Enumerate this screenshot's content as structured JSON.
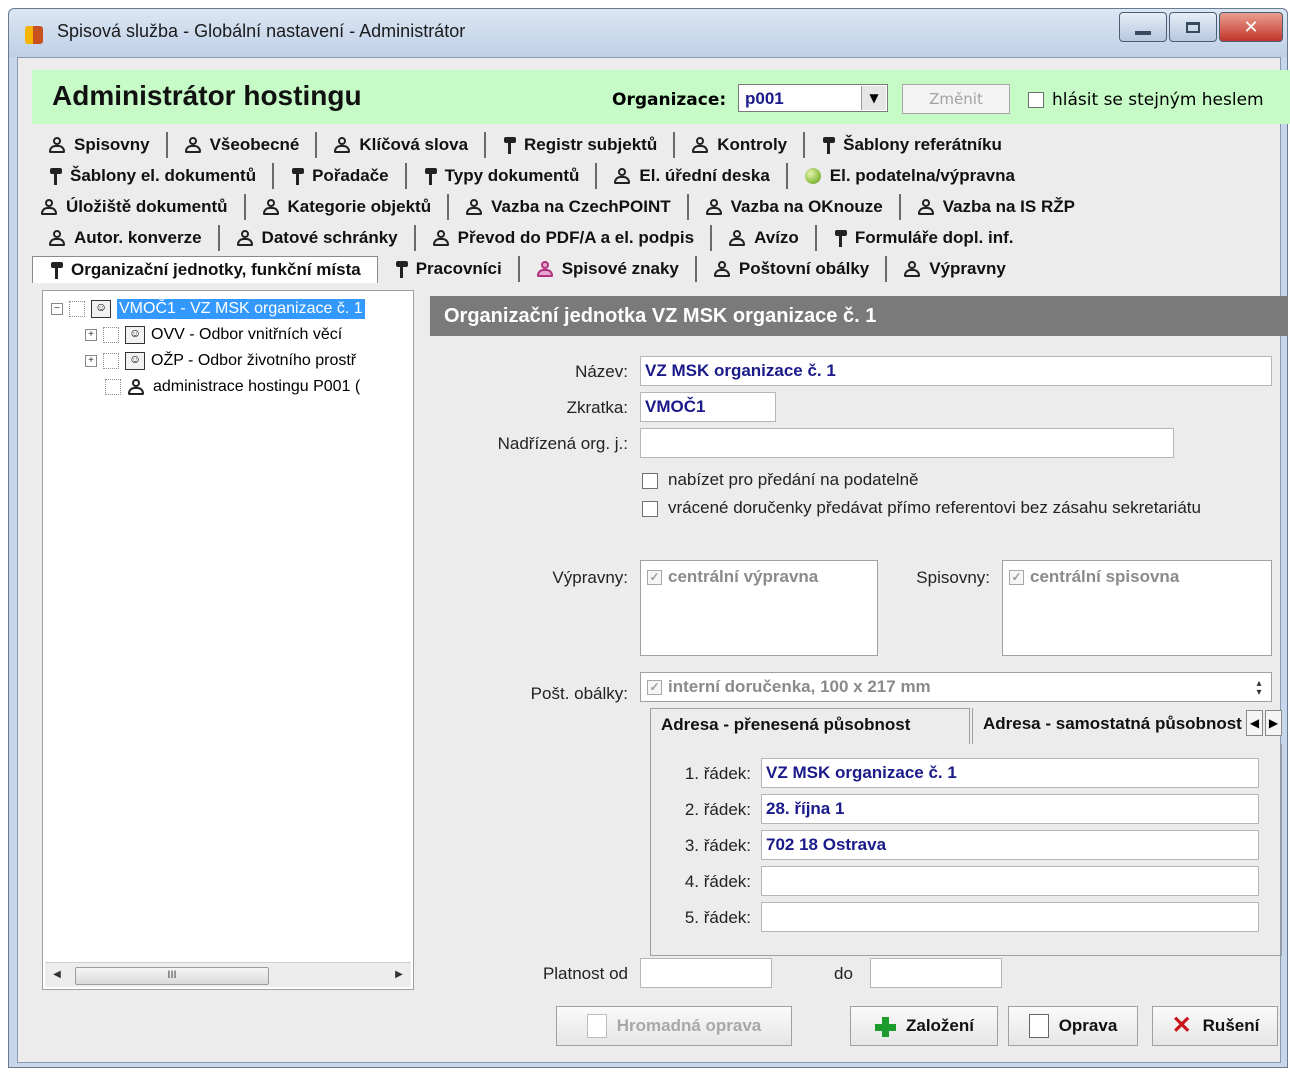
{
  "window": {
    "title": "Spisová služba - Globální nastavení - Administrátor",
    "close_glyph": "✕"
  },
  "header": {
    "app_title": "Administrátor hostingu",
    "org_label": "Organizace:",
    "org_value": "p001",
    "change_button": "Změnit",
    "same_password_label": "hlásit se stejným heslem"
  },
  "tabs": {
    "row1": [
      "Spisovny",
      "Všeobecné",
      "Klíčová slova",
      "Registr subjektů",
      "Kontroly",
      "Šablony referátníku"
    ],
    "row2": [
      "Šablony el. dokumentů",
      "Pořadače",
      "Typy dokumentů",
      "El. úřední deska",
      "El. podatelna/výpravna"
    ],
    "row3": [
      "Úložiště dokumentů",
      "Kategorie objektů",
      "Vazba na CzechPOINT",
      "Vazba na OKnouze",
      "Vazba na IS RŽP"
    ],
    "row4": [
      "Autor. konverze",
      "Datové schránky",
      "Převod do PDF/A a el. podpis",
      "Avízo",
      "Formuláře dopl. inf."
    ],
    "row5": [
      "Organizační jednotky, funkční místa",
      "Pracovníci",
      "Spisové znaky",
      "Poštovní obálky",
      "Výpravny"
    ],
    "active": "Organizační jednotky, funkční místa"
  },
  "tree": {
    "root": "VMOČ1 - VZ MSK organizace č. 1",
    "children": [
      "OVV - Odbor vnitřních věcí",
      "OŽP - Odbor životního prostř",
      "administrace hostingu P001 ("
    ],
    "scroll_grip": "III"
  },
  "form": {
    "section_title": "Organizační jednotka VZ MSK organizace č. 1",
    "name_label": "Název:",
    "name_value": "VZ MSK organizace č. 1",
    "abbr_label": "Zkratka:",
    "abbr_value": "VMOČ1",
    "parent_label": "Nadřízená org. j.:",
    "parent_value": "",
    "checkbox1": "nabízet pro předání na podatelně",
    "checkbox2": "vrácené doručenky předávat přímo referentovi bez zásahu sekretariátu",
    "dispatch_label": "Výpravny:",
    "dispatch_item": "centrální výpravna",
    "registry_label": "Spisovny:",
    "registry_item": "centrální spisovna",
    "envelopes_label": "Pošt. obálky:",
    "envelopes_item": "interní doručenka, 100 x 217 mm",
    "address_tab_active": "Adresa - přenesená působnost",
    "address_tab_inactive": "Adresa - samostatná působnost",
    "address_lines": [
      {
        "label": "1. řádek:",
        "value": "VZ MSK organizace č. 1"
      },
      {
        "label": "2. řádek:",
        "value": "28. října 1"
      },
      {
        "label": "3. řádek:",
        "value": "702 18 Ostrava"
      },
      {
        "label": "4. řádek:",
        "value": ""
      },
      {
        "label": "5. řádek:",
        "value": ""
      }
    ],
    "valid_from_label": "Platnost od",
    "valid_to_label": "do"
  },
  "buttons": {
    "bulk_edit": "Hromadná oprava",
    "create": "Založení",
    "edit": "Oprava",
    "cancel": "Rušení"
  },
  "icons": {
    "tab_person": "person-icon",
    "tab_tree": "tree-icon",
    "tab_globe": "globe-icon",
    "create": "plus-icon",
    "cancel": "x-icon",
    "cancel_glyph": "✕"
  }
}
